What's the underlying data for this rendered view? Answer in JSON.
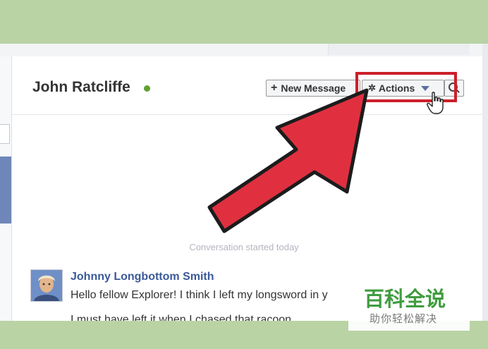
{
  "conversation": {
    "contact_name": "John Ratcliffe",
    "status_color": "#5fa133",
    "started_label": "Conversation started today"
  },
  "toolbar": {
    "new_message_label": "New Message",
    "actions_label": "Actions",
    "search_icon": "magnifier-icon"
  },
  "messages": [
    {
      "sender": "Johnny Longbottom Smith",
      "lines": [
        "Hello fellow Explorer! I think I left my longsword in y",
        "I must have left it when I chased that racoon"
      ]
    }
  ],
  "watermark": {
    "title": "百科全说",
    "subtitle": "助你轻松解决"
  },
  "colors": {
    "annotation_red": "#e03040",
    "link_blue": "#3b5998",
    "page_border_green": "#b9d3a5"
  }
}
